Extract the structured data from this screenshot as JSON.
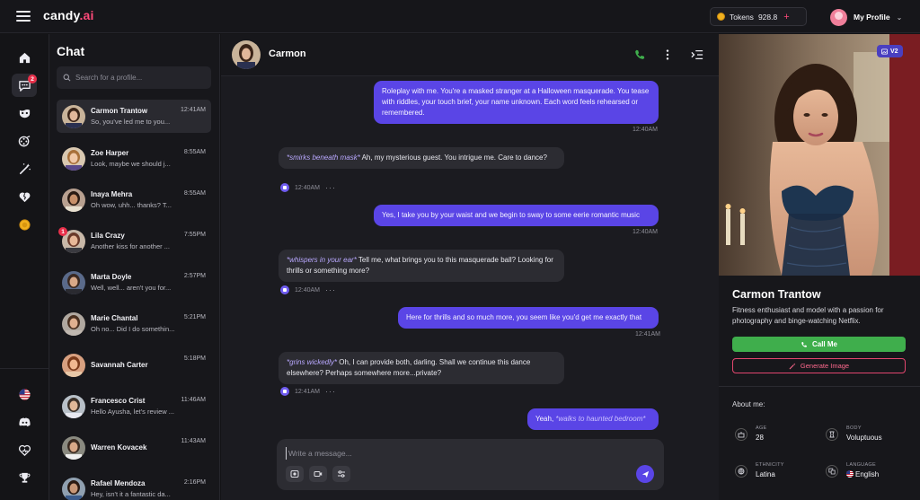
{
  "brand": {
    "name": "candy",
    "suffix": ".ai"
  },
  "topbar": {
    "tokens_label": "Tokens",
    "tokens_value": "928.8",
    "tokens_plus": "+",
    "profile_label": "My Profile"
  },
  "rail": {
    "chat_badge": "2"
  },
  "chatlist": {
    "title": "Chat",
    "search_placeholder": "Search for a profile...",
    "items": [
      {
        "name": "Carmon Trantow",
        "preview": "So, you've led me to you...",
        "time": "12:41AM"
      },
      {
        "name": "Zoe Harper",
        "preview": "Look, maybe we should j...",
        "time": "8:55AM"
      },
      {
        "name": "Inaya Mehra",
        "preview": "Oh wow, uhh... thanks? T...",
        "time": "8:55AM"
      },
      {
        "name": "Lila Crazy",
        "preview": "Another kiss for another ...",
        "time": "7:55PM",
        "badge": "1"
      },
      {
        "name": "Marta Doyle",
        "preview": "Well, well... aren't you for...",
        "time": "2:57PM"
      },
      {
        "name": "Marie Chantal",
        "preview": "Oh no... Did I do somethin...",
        "time": "5:21PM"
      },
      {
        "name": "Savannah Carter",
        "preview": "",
        "time": "5:18PM"
      },
      {
        "name": "Francesco Crist",
        "preview": "Hello Ayusha, let's review ...",
        "time": "11:46AM"
      },
      {
        "name": "Warren Kovacek",
        "preview": "",
        "time": "11:43AM"
      },
      {
        "name": "Rafael Mendoza",
        "preview": "Hey, isn't it a fantastic da...",
        "time": "2:16PM"
      }
    ]
  },
  "chat": {
    "header_name": "Carmon",
    "messages": [
      {
        "from": "user",
        "text": "Roleplay with me. You're a masked stranger at a Halloween masquerade. You tease with riddles, your touch brief, your name unknown. Each word feels rehearsed or remembered.",
        "time": "12:40AM"
      },
      {
        "from": "bot",
        "action": "*smirks beneath mask*",
        "text": " Ah, my mysterious guest. You intrigue me. Care to dance?",
        "time": "12:40AM"
      },
      {
        "from": "user",
        "text": "Yes, I take you by your waist and we begin to sway to some eerie romantic music",
        "time": "12:40AM"
      },
      {
        "from": "bot",
        "action": "*whispers in your ear*",
        "text": " Tell me, what brings you to this masquerade ball? Looking for thrills or something more?",
        "time": "12:40AM"
      },
      {
        "from": "user",
        "text": "Here for thrills and so much more, you seem like you'd get me exactly that",
        "time": "12:41AM"
      },
      {
        "from": "bot",
        "action": "*grins wickedly*",
        "text": " Oh, I can provide both, darling. Shall we continue this dance elsewhere? Perhaps somewhere more...private?",
        "time": "12:41AM"
      },
      {
        "from": "user",
        "text": "Yeah, ",
        "action": "*walks to haunted bedroom*",
        "time": ""
      }
    ],
    "composer_placeholder": "Write a message..."
  },
  "panel": {
    "version_badge": "V2",
    "name": "Carmon Trantow",
    "description": "Fitness enthusiast and model with a passion for photography and binge-watching Netflix.",
    "call_label": "Call Me",
    "generate_label": "Generate Image",
    "about_label": "About me:",
    "attributes": [
      {
        "key": "AGE",
        "value": "28"
      },
      {
        "key": "BODY",
        "value": "Voluptuous"
      },
      {
        "key": "ETHNICITY",
        "value": "Latina"
      },
      {
        "key": "LANGUAGE",
        "value": "English"
      }
    ]
  }
}
